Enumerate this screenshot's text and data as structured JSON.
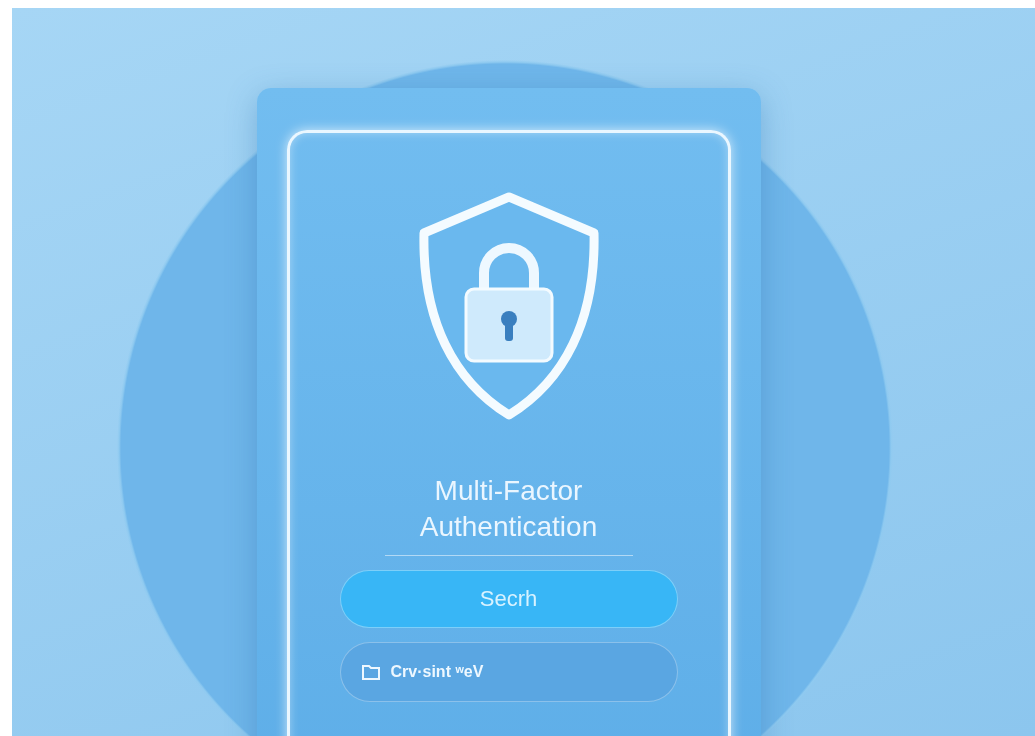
{
  "title": "Multi-Factor Authentication",
  "primary_button": {
    "label": "Secrh"
  },
  "secondary_button": {
    "label": "Crv·sint ʷeV"
  }
}
